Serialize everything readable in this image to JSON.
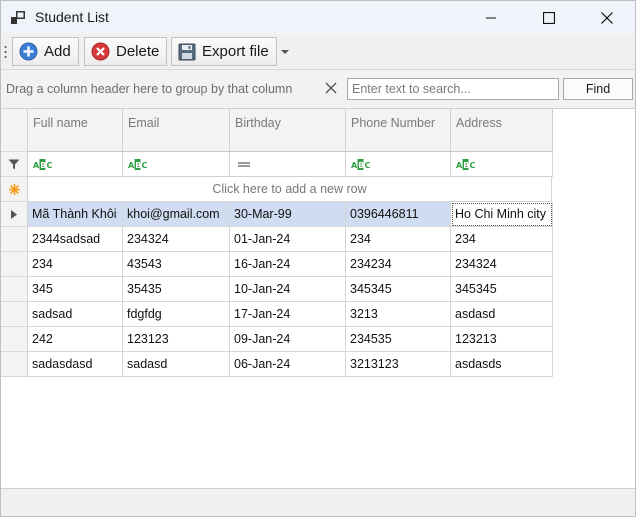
{
  "window": {
    "title": "Student List"
  },
  "toolbar": {
    "add_label": "Add",
    "delete_label": "Delete",
    "export_label": "Export file"
  },
  "groupbar": {
    "hint": "Drag a column header here to group by that column",
    "search_placeholder": "Enter text to search...",
    "find_label": "Find"
  },
  "grid": {
    "columns": [
      "Full name",
      "Email",
      "Birthday",
      "Phone Number",
      "Address"
    ],
    "new_row_text": "Click here to add a new row",
    "rows": [
      [
        "Mã Thành Khôi",
        "khoi@gmail.com",
        "30-Mar-99",
        "0396446811",
        "Ho Chi Minh city"
      ],
      [
        "2344sadsad",
        "234324",
        "01-Jan-24",
        "234",
        "234"
      ],
      [
        "234",
        "43543",
        "16-Jan-24",
        "234234",
        "234324"
      ],
      [
        "345",
        "35435",
        "10-Jan-24",
        "345345",
        "345345"
      ],
      [
        "sadsad",
        "fdgfdg",
        "17-Jan-24",
        "3213",
        "asdasd"
      ],
      [
        "242",
        "123123",
        "09-Jan-24",
        "234535",
        "123213"
      ],
      [
        "sadasdasd",
        "sadasd",
        "06-Jan-24",
        "3213123",
        "asdasds"
      ]
    ]
  },
  "colors": {
    "selected_row": "#cfdcf1",
    "add_icon": "#3d7fd6",
    "delete_icon": "#d63a3a",
    "filter_icon": "#2f9e44",
    "new_row_icon": "#f59a1b"
  }
}
